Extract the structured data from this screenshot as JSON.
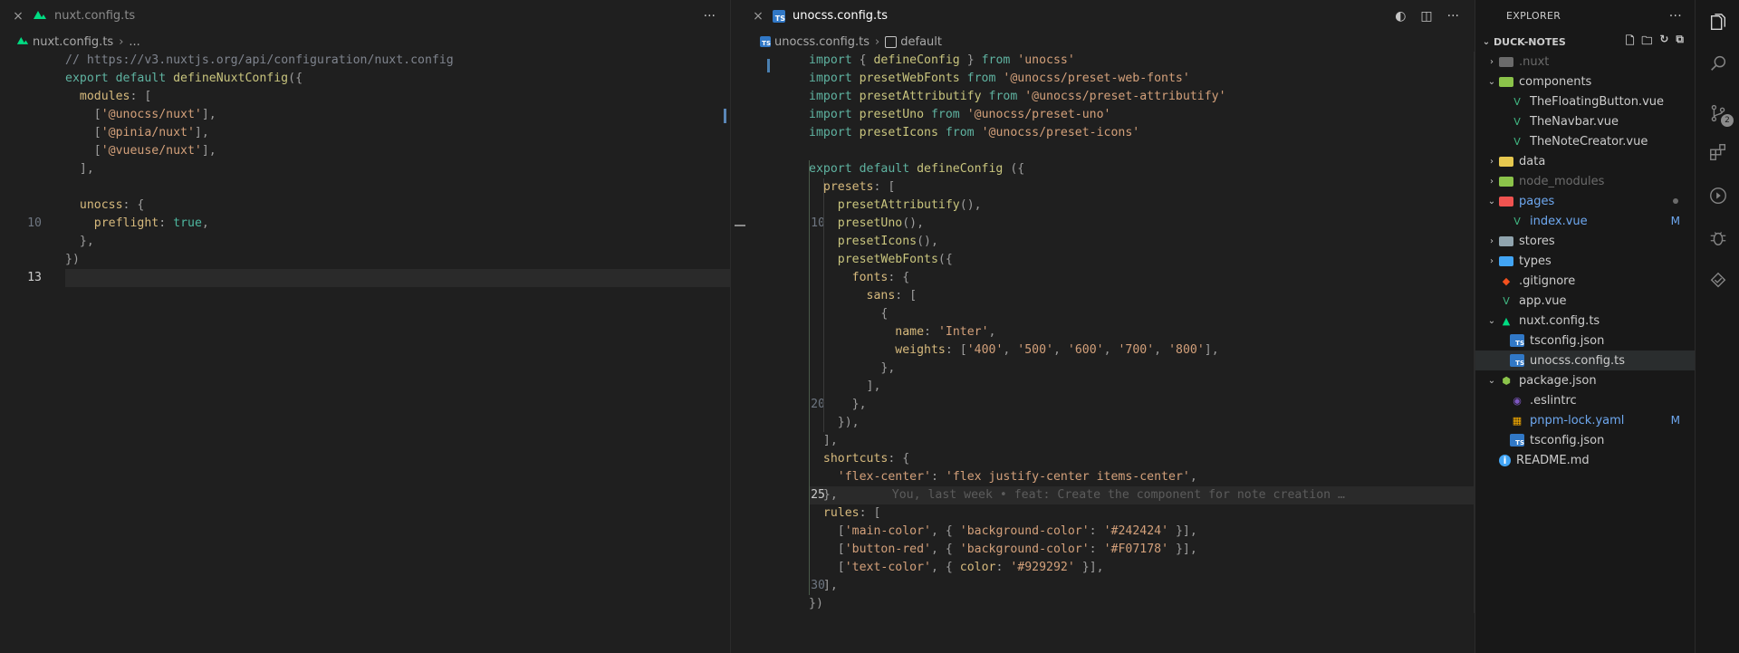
{
  "left_editor": {
    "tab": {
      "label": "nuxt.config.ts",
      "close": "×"
    },
    "actions_more": "···",
    "breadcrumb": {
      "file": "nuxt.config.ts",
      "sep": "›",
      "rest": "..."
    },
    "lines": [
      {
        "n": "",
        "tokens": [
          [
            "cm",
            "// "
          ],
          [
            "cm",
            "https://v3.nuxtjs.org/api/configuration/nuxt.config"
          ]
        ]
      },
      {
        "n": "",
        "tokens": [
          [
            "kw",
            "export default "
          ],
          [
            "fn",
            "defineNuxtConfig"
          ],
          [
            "pn",
            "({"
          ]
        ]
      },
      {
        "n": "",
        "tokens": [
          [
            "pn",
            "  "
          ],
          [
            "pr",
            "modules"
          ],
          [
            "pn",
            ": ["
          ]
        ]
      },
      {
        "n": "",
        "tokens": [
          [
            "pn",
            "    ["
          ],
          [
            "st",
            "'@unocss/nuxt'"
          ],
          [
            "pn",
            "],"
          ]
        ]
      },
      {
        "n": "",
        "tokens": [
          [
            "pn",
            "    ["
          ],
          [
            "st",
            "'@pinia/nuxt'"
          ],
          [
            "pn",
            "],"
          ]
        ]
      },
      {
        "n": "",
        "tokens": [
          [
            "pn",
            "    ["
          ],
          [
            "st",
            "'@vueuse/nuxt'"
          ],
          [
            "pn",
            "],"
          ]
        ]
      },
      {
        "n": "",
        "tokens": [
          [
            "pn",
            "  ],"
          ]
        ]
      },
      {
        "n": "",
        "tokens": []
      },
      {
        "n": "",
        "tokens": [
          [
            "pn",
            "  "
          ],
          [
            "pr",
            "unocss"
          ],
          [
            "pn",
            ": {"
          ]
        ]
      },
      {
        "n": "10",
        "tokens": [
          [
            "pn",
            "    "
          ],
          [
            "pr",
            "preflight"
          ],
          [
            "pn",
            ": "
          ],
          [
            "bool",
            "true"
          ],
          [
            "pn",
            ","
          ]
        ]
      },
      {
        "n": "",
        "tokens": [
          [
            "pn",
            "  },"
          ]
        ]
      },
      {
        "n": "",
        "tokens": [
          [
            "pn",
            "})"
          ]
        ]
      },
      {
        "n": "13",
        "tokens": [],
        "current": true
      }
    ]
  },
  "right_editor": {
    "tab": {
      "label": "unocss.config.ts",
      "close": "×"
    },
    "actions": [
      "◐",
      "◫",
      "···"
    ],
    "breadcrumb": {
      "file": "unocss.config.ts",
      "sep": "›",
      "symbol": "default"
    },
    "blame": "You, last week • feat: Create the component for note creation …",
    "lines": [
      {
        "n": "",
        "tokens": [
          [
            "kw",
            "import "
          ],
          [
            "pn",
            "{ "
          ],
          [
            "fn",
            "defineConfig"
          ],
          [
            "pn",
            " } "
          ],
          [
            "kw",
            "from "
          ],
          [
            "st",
            "'unocss'"
          ]
        ]
      },
      {
        "n": "",
        "tokens": [
          [
            "kw",
            "import "
          ],
          [
            "fn",
            "presetWebFonts "
          ],
          [
            "kw",
            "from "
          ],
          [
            "st",
            "'@unocss/preset-web-fonts'"
          ]
        ]
      },
      {
        "n": "",
        "tokens": [
          [
            "kw",
            "import "
          ],
          [
            "fn",
            "presetAttributify "
          ],
          [
            "kw",
            "from "
          ],
          [
            "st",
            "'@unocss/preset-attributify'"
          ]
        ]
      },
      {
        "n": "",
        "tokens": [
          [
            "kw",
            "import "
          ],
          [
            "fn",
            "presetUno "
          ],
          [
            "kw",
            "from "
          ],
          [
            "st",
            "'@unocss/preset-uno'"
          ]
        ]
      },
      {
        "n": "",
        "tokens": [
          [
            "kw",
            "import "
          ],
          [
            "fn",
            "presetIcons "
          ],
          [
            "kw",
            "from "
          ],
          [
            "st",
            "'@unocss/preset-icons'"
          ]
        ]
      },
      {
        "n": "",
        "tokens": []
      },
      {
        "n": "",
        "tokens": [
          [
            "kw",
            "export default "
          ],
          [
            "fn",
            "defineConfig "
          ],
          [
            "pn",
            "({"
          ]
        ]
      },
      {
        "n": "",
        "tokens": [
          [
            "pn",
            "  "
          ],
          [
            "pr",
            "presets"
          ],
          [
            "pn",
            ": ["
          ]
        ]
      },
      {
        "n": "",
        "tokens": [
          [
            "pn",
            "    "
          ],
          [
            "fn",
            "presetAttributify"
          ],
          [
            "pn",
            "(),"
          ]
        ]
      },
      {
        "n": "10",
        "tokens": [
          [
            "pn",
            "    "
          ],
          [
            "fn",
            "presetUno"
          ],
          [
            "pn",
            "(),"
          ]
        ]
      },
      {
        "n": "",
        "tokens": [
          [
            "pn",
            "    "
          ],
          [
            "fn",
            "presetIcons"
          ],
          [
            "pn",
            "(),"
          ]
        ]
      },
      {
        "n": "",
        "tokens": [
          [
            "pn",
            "    "
          ],
          [
            "fn",
            "presetWebFonts"
          ],
          [
            "pn",
            "({"
          ]
        ]
      },
      {
        "n": "",
        "tokens": [
          [
            "pn",
            "      "
          ],
          [
            "pr",
            "fonts"
          ],
          [
            "pn",
            ": {"
          ]
        ]
      },
      {
        "n": "",
        "tokens": [
          [
            "pn",
            "        "
          ],
          [
            "pr",
            "sans"
          ],
          [
            "pn",
            ": ["
          ]
        ]
      },
      {
        "n": "",
        "tokens": [
          [
            "pn",
            "          {"
          ]
        ]
      },
      {
        "n": "",
        "tokens": [
          [
            "pn",
            "            "
          ],
          [
            "pr",
            "name"
          ],
          [
            "pn",
            ": "
          ],
          [
            "st",
            "'Inter'"
          ],
          [
            "pn",
            ","
          ]
        ]
      },
      {
        "n": "",
        "tokens": [
          [
            "pn",
            "            "
          ],
          [
            "pr",
            "weights"
          ],
          [
            "pn",
            ": ["
          ],
          [
            "st",
            "'400'"
          ],
          [
            "pn",
            ", "
          ],
          [
            "st",
            "'500'"
          ],
          [
            "pn",
            ", "
          ],
          [
            "st",
            "'600'"
          ],
          [
            "pn",
            ", "
          ],
          [
            "st",
            "'700'"
          ],
          [
            "pn",
            ", "
          ],
          [
            "st",
            "'800'"
          ],
          [
            "pn",
            "],"
          ]
        ]
      },
      {
        "n": "",
        "tokens": [
          [
            "pn",
            "          },"
          ]
        ]
      },
      {
        "n": "",
        "tokens": [
          [
            "pn",
            "        ],"
          ]
        ]
      },
      {
        "n": "20",
        "tokens": [
          [
            "pn",
            "      },"
          ]
        ]
      },
      {
        "n": "",
        "tokens": [
          [
            "pn",
            "    }),"
          ]
        ]
      },
      {
        "n": "",
        "tokens": [
          [
            "pn",
            "  ],"
          ]
        ]
      },
      {
        "n": "",
        "tokens": [
          [
            "pn",
            "  "
          ],
          [
            "pr",
            "shortcuts"
          ],
          [
            "pn",
            ": {"
          ]
        ]
      },
      {
        "n": "",
        "tokens": [
          [
            "pn",
            "    "
          ],
          [
            "st",
            "'flex-center'"
          ],
          [
            "pn",
            ": "
          ],
          [
            "st",
            "'flex justify-center items-center'"
          ],
          [
            "pn",
            ","
          ]
        ]
      },
      {
        "n": "25",
        "tokens": [
          [
            "pn",
            "  },"
          ]
        ],
        "current": true,
        "blame": true
      },
      {
        "n": "",
        "tokens": [
          [
            "pn",
            "  "
          ],
          [
            "pr",
            "rules"
          ],
          [
            "pn",
            ": ["
          ]
        ]
      },
      {
        "n": "",
        "tokens": [
          [
            "pn",
            "    ["
          ],
          [
            "st",
            "'main-color'"
          ],
          [
            "pn",
            ", { "
          ],
          [
            "st",
            "'background-color'"
          ],
          [
            "pn",
            ": "
          ],
          [
            "st",
            "'#242424'"
          ],
          [
            "pn",
            " }],"
          ]
        ]
      },
      {
        "n": "",
        "tokens": [
          [
            "pn",
            "    ["
          ],
          [
            "st",
            "'button-red'"
          ],
          [
            "pn",
            ", { "
          ],
          [
            "st",
            "'background-color'"
          ],
          [
            "pn",
            ": "
          ],
          [
            "st",
            "'#F07178'"
          ],
          [
            "pn",
            " }],"
          ]
        ]
      },
      {
        "n": "",
        "tokens": [
          [
            "pn",
            "    ["
          ],
          [
            "st",
            "'text-color'"
          ],
          [
            "pn",
            ", { "
          ],
          [
            "pr",
            "color"
          ],
          [
            "pn",
            ": "
          ],
          [
            "st",
            "'#929292'"
          ],
          [
            "pn",
            " }],"
          ]
        ]
      },
      {
        "n": "30",
        "tokens": [
          [
            "pn",
            "  ],"
          ]
        ]
      },
      {
        "n": "",
        "tokens": [
          [
            "pn",
            "})"
          ]
        ]
      }
    ]
  },
  "explorer": {
    "title": "EXPLORER",
    "more": "···",
    "root": {
      "label": "DUCK-NOTES",
      "chevron": "⌄"
    },
    "items": [
      {
        "label": ".nuxt",
        "depth": 1,
        "chev": "›",
        "icon": "folder",
        "color": "#6b6b6b",
        "dim": true
      },
      {
        "label": "components",
        "depth": 1,
        "chev": "⌄",
        "icon": "folder-components",
        "color": "#8bc34a"
      },
      {
        "label": "TheFloatingButton.vue",
        "depth": 2,
        "chev": "",
        "icon": "vue",
        "color": "#41b883"
      },
      {
        "label": "TheNavbar.vue",
        "depth": 2,
        "chev": "",
        "icon": "vue",
        "color": "#41b883"
      },
      {
        "label": "TheNoteCreator.vue",
        "depth": 2,
        "chev": "",
        "icon": "vue",
        "color": "#41b883"
      },
      {
        "label": "data",
        "depth": 1,
        "chev": "›",
        "icon": "folder-data",
        "color": "#e6c84f"
      },
      {
        "label": "node_modules",
        "depth": 1,
        "chev": "›",
        "icon": "folder-node",
        "color": "#8bc34a",
        "dim": true
      },
      {
        "label": "pages",
        "depth": 1,
        "chev": "⌄",
        "icon": "folder-pages",
        "color": "#ef5350",
        "blue": true,
        "dot": true
      },
      {
        "label": "index.vue",
        "depth": 2,
        "chev": "",
        "icon": "vue",
        "color": "#41b883",
        "blue": true,
        "mod": "M"
      },
      {
        "label": "stores",
        "depth": 1,
        "chev": "›",
        "icon": "folder",
        "color": "#90a4ae"
      },
      {
        "label": "types",
        "depth": 1,
        "chev": "›",
        "icon": "folder-types",
        "color": "#42a5f5"
      },
      {
        "label": ".gitignore",
        "depth": 1,
        "chev": "",
        "icon": "git",
        "color": "#f4511e"
      },
      {
        "label": "app.vue",
        "depth": 1,
        "chev": "",
        "icon": "vue",
        "color": "#41b883"
      },
      {
        "label": "nuxt.config.ts",
        "depth": 1,
        "chev": "⌄",
        "icon": "nuxt",
        "color": "#00dc82"
      },
      {
        "label": "tsconfig.json",
        "depth": 2,
        "chev": "",
        "icon": "ts",
        "color": "#3178c6"
      },
      {
        "label": "unocss.config.ts",
        "depth": 2,
        "chev": "",
        "icon": "ts",
        "color": "#3178c6",
        "selected": true
      },
      {
        "label": "package.json",
        "depth": 1,
        "chev": "⌄",
        "icon": "npm",
        "color": "#8bc34a"
      },
      {
        "label": ".eslintrc",
        "depth": 2,
        "chev": "",
        "icon": "eslint",
        "color": "#7e57c2"
      },
      {
        "label": "pnpm-lock.yaml",
        "depth": 2,
        "chev": "",
        "icon": "pnpm",
        "color": "#f9ad00",
        "blue": true,
        "mod": "M"
      },
      {
        "label": "tsconfig.json",
        "depth": 2,
        "chev": "",
        "icon": "ts",
        "color": "#3178c6"
      },
      {
        "label": "README.md",
        "depth": 1,
        "chev": "",
        "icon": "info",
        "color": "#42a5f5"
      }
    ]
  },
  "activity": {
    "items": [
      "files-icon",
      "search-icon",
      "source-control-icon",
      "extensions-icon",
      "run-icon",
      "debug-icon",
      "remote-icon"
    ],
    "scm_badge": "2"
  }
}
